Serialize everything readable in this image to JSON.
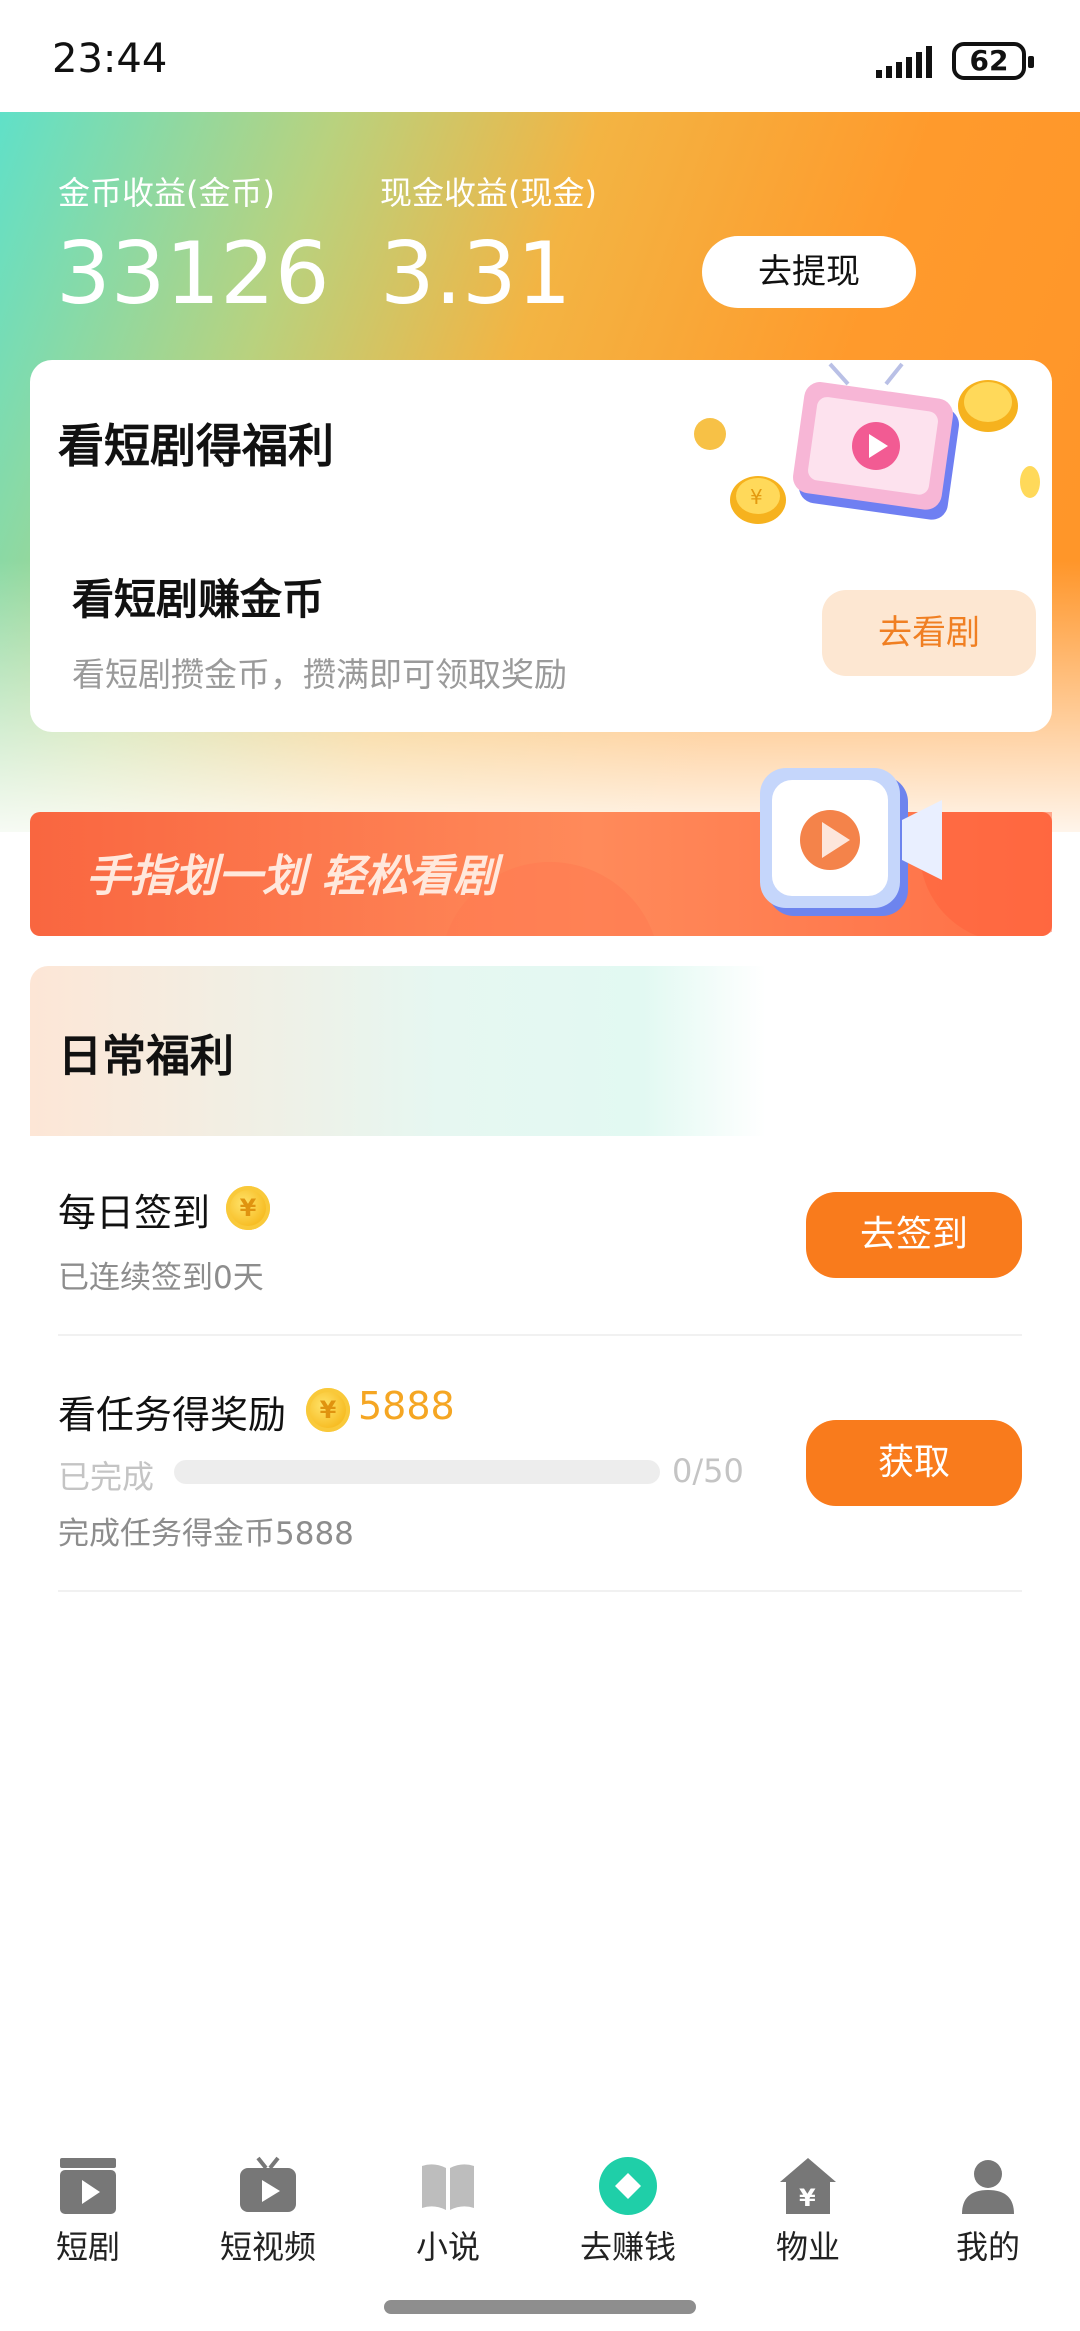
{
  "status_bar": {
    "time": "23:44",
    "battery": "62"
  },
  "earnings": {
    "coin_label": "金币收益(金币)",
    "coin_value": "33126",
    "cash_label": "现金收益(现金)",
    "cash_value": "3.31",
    "withdraw_button": "去提现"
  },
  "drama_card": {
    "title": "看短剧得福利",
    "subtitle": "看短剧赚金币",
    "description": "看短剧攒金币，攒满即可领取奖励",
    "button": "去看剧"
  },
  "banner": {
    "text": "手指划一划 轻松看剧"
  },
  "daily": {
    "title": "日常福利",
    "tasks": [
      {
        "title": "每日签到",
        "subtitle": "已连续签到0天",
        "button": "去签到"
      },
      {
        "title": "看任务得奖励",
        "reward": "5888",
        "progress_label": "已完成",
        "progress_count": "0/50",
        "progress_fraction": 0,
        "subtitle": "完成任务得金币5888",
        "button": "获取"
      }
    ]
  },
  "bottom_nav": [
    {
      "label": "短剧",
      "icon": "clapper-play-icon"
    },
    {
      "label": "短视频",
      "icon": "tv-play-icon"
    },
    {
      "label": "小说",
      "icon": "book-icon"
    },
    {
      "label": "去赚钱",
      "icon": "diamond-coin-icon",
      "active": true
    },
    {
      "label": "物业",
      "icon": "house-yen-icon"
    },
    {
      "label": "我的",
      "icon": "person-icon"
    }
  ],
  "colors": {
    "accent": "#f97b1c",
    "active_nav": "#1fcfa8",
    "muted": "#8d8d8d"
  }
}
